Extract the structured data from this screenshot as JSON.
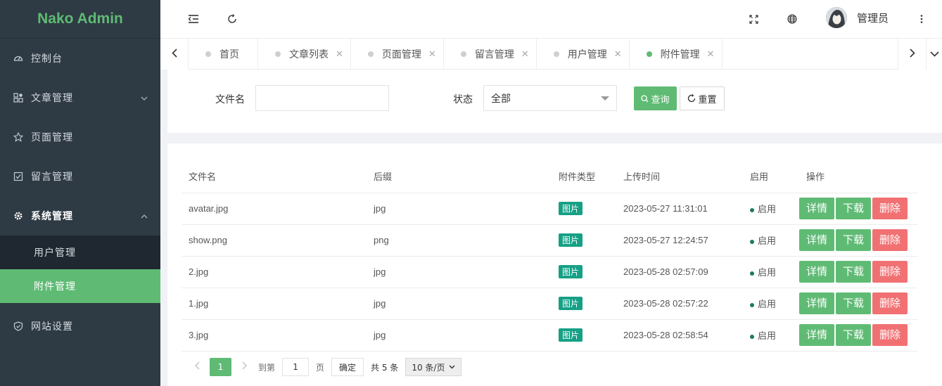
{
  "app": {
    "title": "Nako Admin"
  },
  "sidebar": {
    "items": [
      {
        "label": "控制台",
        "icon": "dashboard-icon"
      },
      {
        "label": "文章管理",
        "icon": "article-icon"
      },
      {
        "label": "页面管理",
        "icon": "star-icon"
      },
      {
        "label": "留言管理",
        "icon": "edit-square-icon"
      },
      {
        "label": "系统管理",
        "icon": "gear-icon"
      },
      {
        "label": "网站设置",
        "icon": "shield-icon"
      }
    ],
    "sub_items": [
      {
        "label": "用户管理"
      },
      {
        "label": "附件管理"
      }
    ]
  },
  "header": {
    "username": "管理员"
  },
  "tabs": [
    {
      "label": "首页"
    },
    {
      "label": "文章列表"
    },
    {
      "label": "页面管理"
    },
    {
      "label": "留言管理"
    },
    {
      "label": "用户管理"
    },
    {
      "label": "附件管理"
    }
  ],
  "filter": {
    "filename_label": "文件名",
    "filename_value": "",
    "status_label": "状态",
    "status_value": "全部",
    "search_label": "查询",
    "reset_label": "重置"
  },
  "table": {
    "headers": [
      "文件名",
      "后缀",
      "附件类型",
      "上传时间",
      "启用",
      "操作"
    ],
    "rows": [
      {
        "name": "avatar.jpg",
        "ext": "jpg",
        "type": "图片",
        "time": "2023-05-27 11:31:01",
        "status": "启用"
      },
      {
        "name": "show.png",
        "ext": "png",
        "type": "图片",
        "time": "2023-05-27 12:24:57",
        "status": "启用"
      },
      {
        "name": "2.jpg",
        "ext": "jpg",
        "type": "图片",
        "time": "2023-05-28 02:57:09",
        "status": "启用"
      },
      {
        "name": "1.jpg",
        "ext": "jpg",
        "type": "图片",
        "time": "2023-05-28 02:57:22",
        "status": "启用"
      },
      {
        "name": "3.jpg",
        "ext": "jpg",
        "type": "图片",
        "time": "2023-05-28 02:58:54",
        "status": "启用"
      }
    ],
    "actions": {
      "detail": "详情",
      "download": "下载",
      "delete": "删除"
    }
  },
  "pagination": {
    "current": "1",
    "goto_label": "到第",
    "goto_value": "1",
    "page_label": "页",
    "confirm_label": "确定",
    "total_label": "共 5 条",
    "page_size": "10 条/页"
  },
  "colors": {
    "accent": "#5fbb74",
    "sidebar": "#2e3a44",
    "danger": "#f17173",
    "tag": "#16a085"
  }
}
